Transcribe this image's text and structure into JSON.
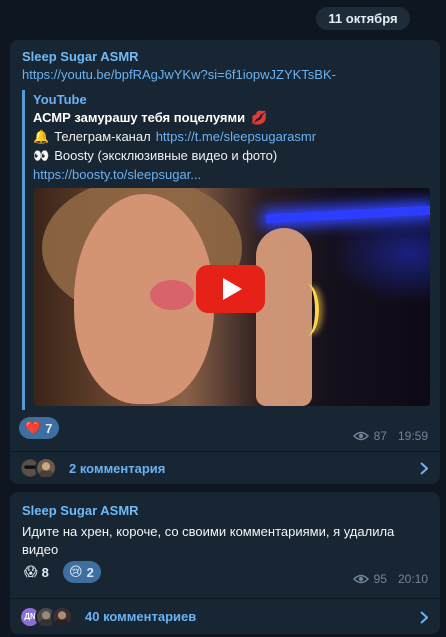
{
  "date_divider": "11 октября",
  "post1": {
    "sender": "Sleep Sugar ASMR",
    "url": "https://youtu.be/bpfRAgJwYKw?si=6f1iopwJZYKTsBK-",
    "preview": {
      "site": "YouTube",
      "title": "АСМР замурашу тебя поцелуями",
      "title_emoji": "💋",
      "line1_emoji": "🔔",
      "line1_text": "Телеграм-канал ",
      "line1_link": "https://t.me/sleepsugarasmr",
      "line2_emoji": "👀",
      "line2_text": "Boosty (эксклюзивные видео и фото)",
      "line3_link": "https://boosty.to/sleepsugar..."
    },
    "reactions": [
      {
        "emoji": "❤️",
        "count": "7"
      }
    ],
    "views": "87",
    "time": "19:59",
    "comments_label": "2 комментария"
  },
  "post2": {
    "sender": "Sleep Sugar ASMR",
    "text": "Идите на хрен, короче, со своими комментариями, я удалила видео",
    "reactions": [
      {
        "emoji": "😱",
        "count": "8"
      },
      {
        "emoji": "😢",
        "count": "2"
      }
    ],
    "views": "95",
    "time": "20:10",
    "avatar_initials": "ДN",
    "comments_label": "40 комментариев"
  },
  "colors": {
    "background": "#0e1621",
    "bubble": "#182533",
    "accent_link": "#6ab2f2",
    "sender": "#71baf5",
    "reaction_bg": "#2b5278",
    "meta": "#708599"
  }
}
